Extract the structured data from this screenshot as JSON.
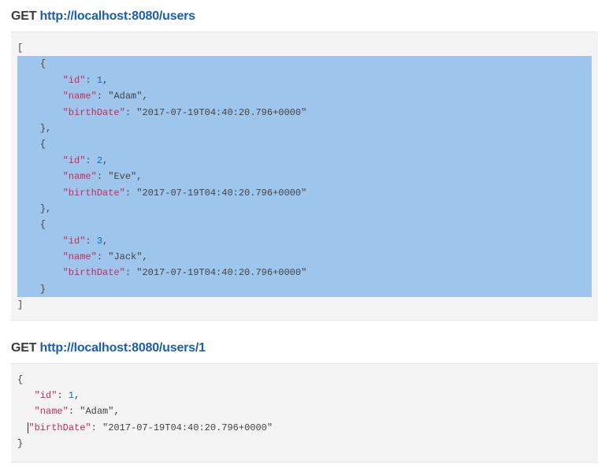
{
  "requests": [
    {
      "method": "GET",
      "url": "http://localhost:8080/users",
      "response": {
        "open_bracket": "[",
        "close_bracket": "]",
        "items": [
          {
            "id": 1,
            "name": "Adam",
            "birthDate": "2017-07-19T04:40:20.796+0000"
          },
          {
            "id": 2,
            "name": "Eve",
            "birthDate": "2017-07-19T04:40:20.796+0000"
          },
          {
            "id": 3,
            "name": "Jack",
            "birthDate": "2017-07-19T04:40:20.796+0000"
          }
        ]
      }
    },
    {
      "method": "GET",
      "url": "http://localhost:8080/users/1",
      "response": {
        "item": {
          "id": 1,
          "name": "Adam",
          "birthDate": "2017-07-19T04:40:20.796+0000"
        }
      }
    }
  ],
  "keys": {
    "id": "\"id\"",
    "name": "\"name\"",
    "birthDate": "\"birthDate\""
  }
}
